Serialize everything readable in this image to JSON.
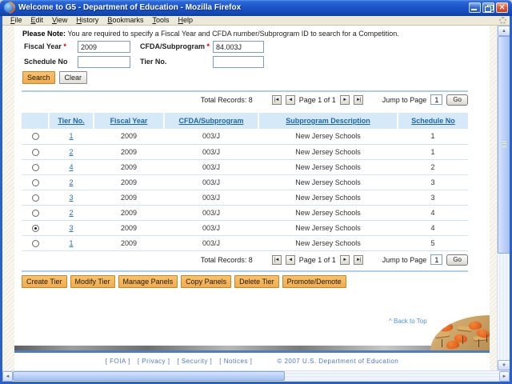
{
  "titlebar": {
    "title": "Welcome to G5 - Department of Education - Mozilla Firefox",
    "close_glyph": "✕"
  },
  "menubar": {
    "items": [
      "File",
      "Edit",
      "View",
      "History",
      "Bookmarks",
      "Tools",
      "Help"
    ]
  },
  "note": {
    "label": "Please Note:",
    "text": "You are required to specify a Fiscal Year and CFDA number/Subprogram ID to search for a Competition."
  },
  "form": {
    "fiscal_year": {
      "label": "Fiscal Year",
      "required_mark": "*",
      "value": "2009"
    },
    "cfda": {
      "label": "CFDA/Subprogram",
      "required_mark": "*",
      "value": "84.003J"
    },
    "schedule_no": {
      "label": "Schedule No",
      "value": ""
    },
    "tier_no": {
      "label": "Tier No.",
      "value": ""
    },
    "search_label": "Search",
    "clear_label": "Clear"
  },
  "pagination": {
    "total_label": "Total Records: 8",
    "page_label": "Page 1 of 1",
    "jump_label": "Jump to Page",
    "jump_value": "1",
    "go_label": "Go",
    "first_icon": "|◄",
    "prev_icon": "◄",
    "next_icon": "►",
    "last_icon": "►|"
  },
  "table": {
    "headers": [
      "Tier No.",
      "Fiscal Year",
      "CFDA/Subprogram",
      "Subprogram Description",
      "Schedule No"
    ],
    "rows": [
      {
        "tier": "1",
        "fiscal_year": "2009",
        "cfda": "003/J",
        "description": "New Jersey Schools",
        "schedule": "1",
        "selected": false
      },
      {
        "tier": "2",
        "fiscal_year": "2009",
        "cfda": "003/J",
        "description": "New Jersey Schools",
        "schedule": "1",
        "selected": false
      },
      {
        "tier": "4",
        "fiscal_year": "2009",
        "cfda": "003/J",
        "description": "New Jersey Schools",
        "schedule": "2",
        "selected": false
      },
      {
        "tier": "2",
        "fiscal_year": "2009",
        "cfda": "003/J",
        "description": "New Jersey Schools",
        "schedule": "3",
        "selected": false
      },
      {
        "tier": "3",
        "fiscal_year": "2009",
        "cfda": "003/J",
        "description": "New Jersey Schools",
        "schedule": "3",
        "selected": false
      },
      {
        "tier": "2",
        "fiscal_year": "2009",
        "cfda": "003/J",
        "description": "New Jersey Schools",
        "schedule": "4",
        "selected": false
      },
      {
        "tier": "3",
        "fiscal_year": "2009",
        "cfda": "003/J",
        "description": "New Jersey Schools",
        "schedule": "4",
        "selected": true
      },
      {
        "tier": "1",
        "fiscal_year": "2009",
        "cfda": "003/J",
        "description": "New Jersey Schools",
        "schedule": "5",
        "selected": false
      }
    ]
  },
  "actions": {
    "buttons": [
      "Create Tier",
      "Modify Tier",
      "Manage Panels",
      "Copy Panels",
      "Delete Tier",
      "Promote/Demote"
    ]
  },
  "misc": {
    "back_to_top_icon": "^",
    "back_to_top_label": "Back to Top"
  },
  "footer": {
    "links": [
      "[  FOIA  ]",
      "[  Privacy  ]",
      "[  Security  ]",
      "[  Notices  ]"
    ],
    "copyright": "©  2007  U.S.  Department  of  Education"
  },
  "scroll_icons": {
    "up": "▲",
    "down": "▼",
    "left": "◄",
    "right": "►"
  },
  "colors": {
    "titlebar_blue": "#1C55C8",
    "button_orange": "#F3AB48",
    "table_header_blue": "#D6E9F8",
    "link_blue": "#2A6DB5",
    "footer_blue": "#4B79C8",
    "divider_blue": "#AECFEB",
    "bottom_bar_blue": "#4E7EC0"
  }
}
